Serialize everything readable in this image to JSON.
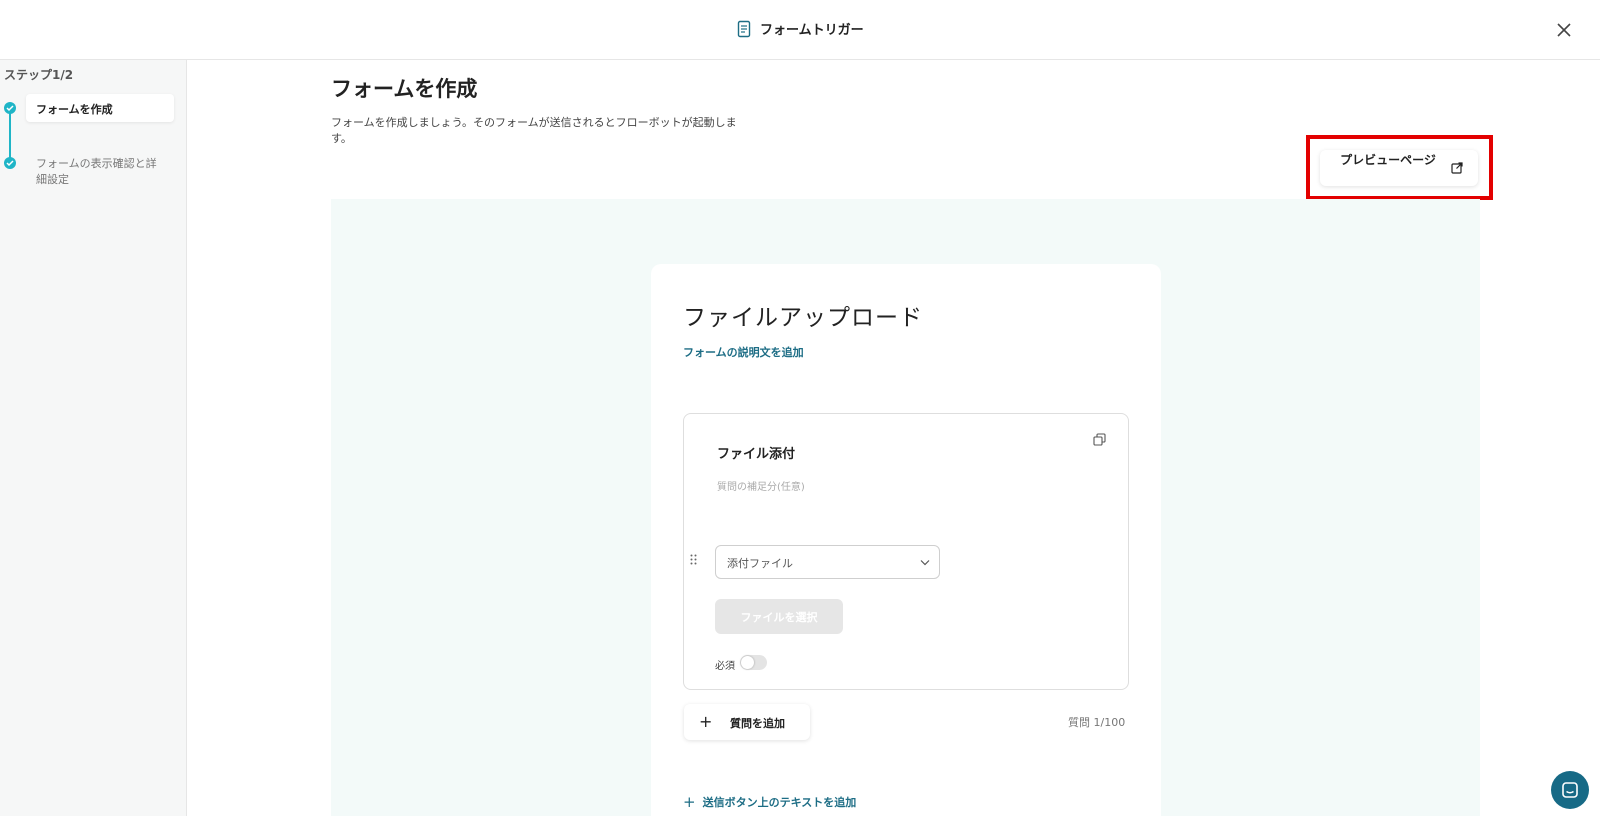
{
  "header": {
    "title": "フォームトリガー"
  },
  "sidebar": {
    "step_label": "ステップ1/2",
    "steps": [
      {
        "label": "フォームを作成",
        "active": true
      },
      {
        "label": "フォームの表示確認と詳細設定",
        "active": false
      }
    ]
  },
  "main": {
    "title": "フォームを作成",
    "description": "フォームを作成しましょう。そのフォームが送信されるとフローボットが起動します。",
    "preview_button": "プレビューページ"
  },
  "form": {
    "title": "ファイルアップロード",
    "add_description_link": "フォームの説明文を追加",
    "question": {
      "title": "ファイル添付",
      "hint_placeholder": "質問の補足分(任意)",
      "type_select": "添付ファイル",
      "file_button": "ファイルを選択",
      "required_label": "必須",
      "required": false
    },
    "add_question_button": "質問を追加",
    "question_count": "質問 1/100",
    "add_submit_text_link": "送信ボタン上のテキストを追加"
  },
  "colors": {
    "accent": "#1fb5c7",
    "link": "#1d6d85",
    "highlight": "#e30000",
    "canvas_bg": "#f3faf9",
    "chat": "#176a86"
  },
  "icons": {
    "header": "form-icon",
    "close": "close-icon",
    "preview": "external-link-icon",
    "copy": "copy-icon",
    "drag": "drag-handle-icon",
    "chevron": "chevron-down-icon",
    "chat": "chat-icon"
  }
}
